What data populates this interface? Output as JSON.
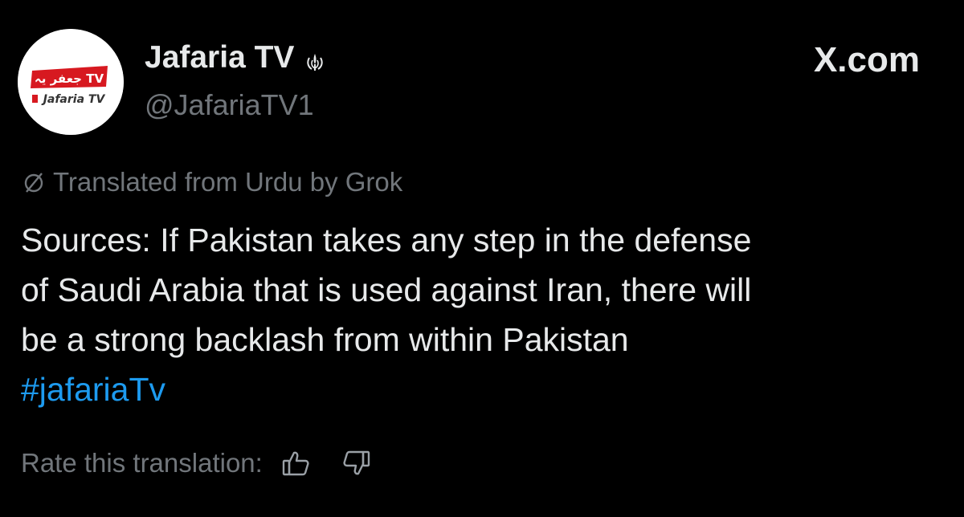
{
  "profile": {
    "display_name": "Jafaria TV",
    "handle": "@JafariaTV1",
    "verified_icon": "emblem-icon",
    "avatar": {
      "logo_text_arabic": "جعفر یہ TV",
      "logo_text_latin": "Jafaria TV",
      "brand_red": "#d71920"
    }
  },
  "source": {
    "brand": "X.com"
  },
  "translation_note": {
    "icon": "translate-icon",
    "text": "Translated from Urdu by Grok"
  },
  "tweet": {
    "lines": [
      "Sources: If Pakistan takes any step in the defense",
      "of Saudi Arabia that is used against Iran, there will",
      "be a strong backlash from within Pakistan"
    ],
    "hashtag": "#jafariaTv"
  },
  "rating": {
    "label": "Rate this translation:",
    "thumbs_up_icon": "thumbs-up-icon",
    "thumbs_down_icon": "thumbs-down-icon"
  },
  "colors": {
    "background": "#000000",
    "text_primary": "#e7e9ea",
    "text_secondary": "#71767b",
    "link": "#1d9bf0"
  }
}
